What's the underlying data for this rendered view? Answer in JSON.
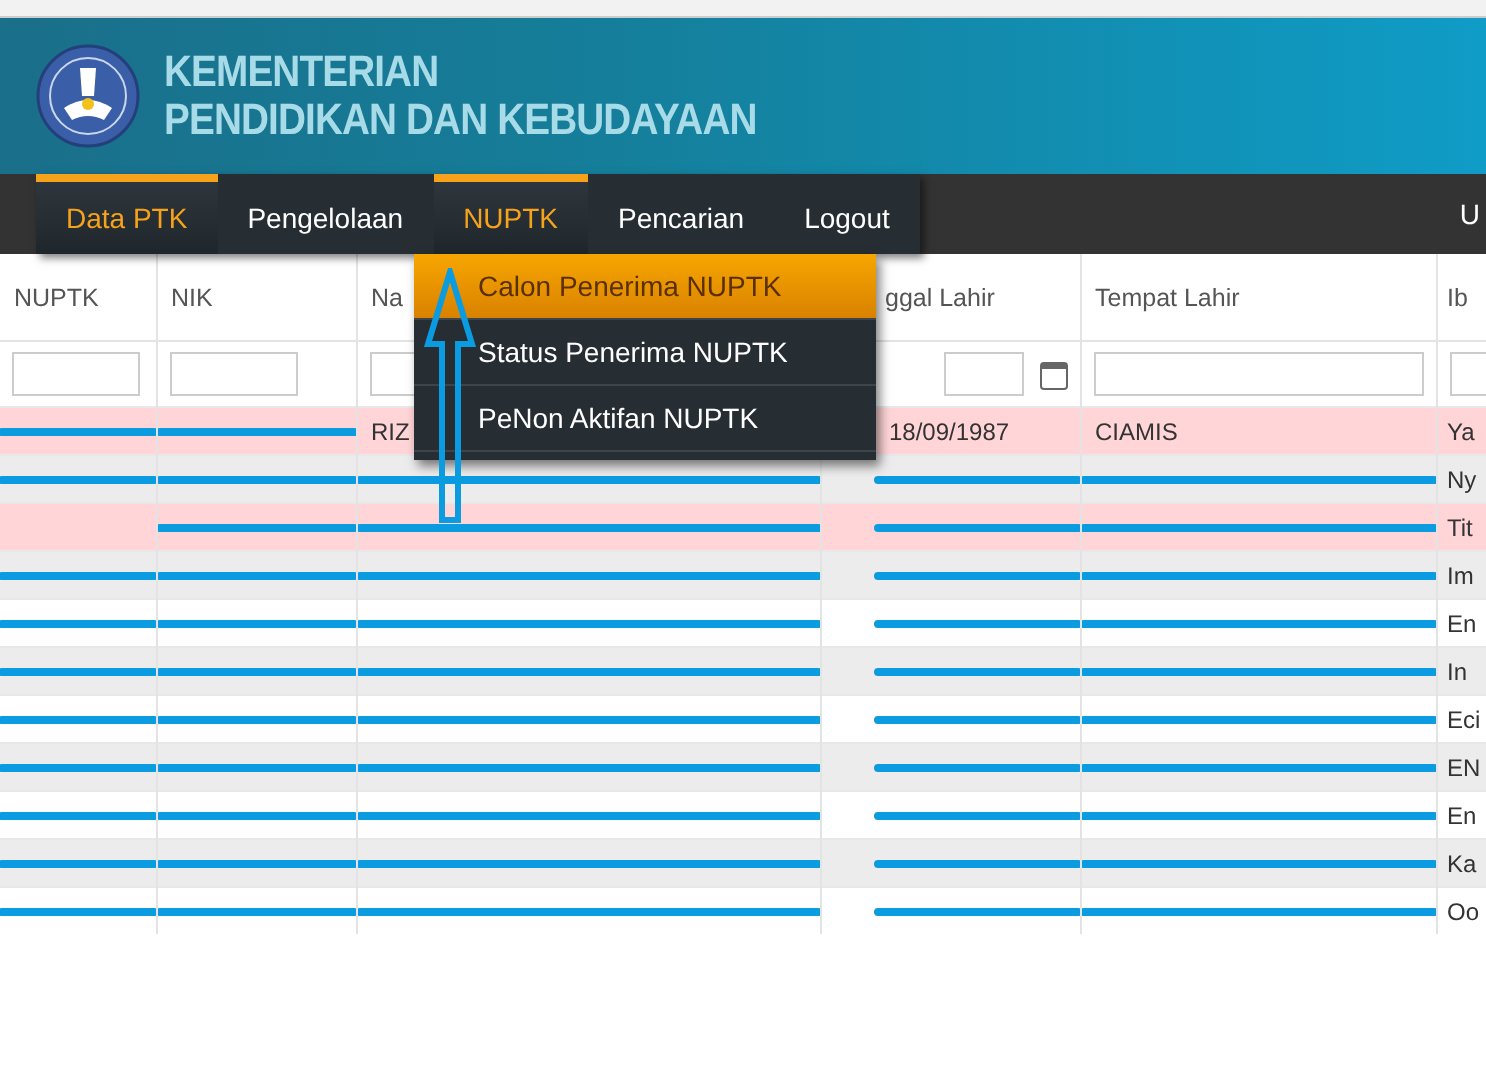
{
  "header": {
    "title_line_1": "KEMENTERIAN",
    "title_line_2": "PENDIDIKAN DAN KEBUDAYAAN"
  },
  "nav": {
    "items": [
      {
        "label": "Data PTK",
        "active": true
      },
      {
        "label": "Pengelolaan",
        "active": false
      },
      {
        "label": "NUPTK",
        "active": true
      },
      {
        "label": "Pencarian",
        "active": false
      },
      {
        "label": "Logout",
        "active": false
      }
    ],
    "user_label": "U"
  },
  "dropdown": {
    "items": [
      {
        "label": "Calon Penerima NUPTK",
        "selected": true
      },
      {
        "label": "Status Penerima NUPTK",
        "selected": false
      },
      {
        "label": "PeNon Aktifan NUPTK",
        "selected": false
      }
    ]
  },
  "table": {
    "columns": [
      {
        "label": "NUPTK",
        "kind": "text"
      },
      {
        "label": "NIK",
        "kind": "text"
      },
      {
        "label": "Na",
        "kind": "text"
      },
      {
        "label": "ggal Lahir",
        "kind": "date"
      },
      {
        "label": "Tempat Lahir",
        "kind": "text"
      },
      {
        "label": "Ib",
        "kind": "text"
      }
    ],
    "rows": [
      {
        "flagged": true,
        "cells": [
          {
            "scribbled": true
          },
          {
            "scribbled": true
          },
          {
            "text": "RIZ",
            "scribbled": false
          },
          {
            "text": "18/09/1987",
            "scribbled": false
          },
          {
            "text": "CIAMIS",
            "scribbled": false
          },
          {
            "text": "Ya",
            "scribbled": false
          }
        ]
      },
      {
        "flagged": false,
        "cells": [
          {
            "scribbled": true
          },
          {
            "scribbled": true
          },
          {
            "scribbled": true
          },
          {
            "scribbled": true
          },
          {
            "scribbled": true
          },
          {
            "text": "Ny",
            "scribbled": false
          }
        ]
      },
      {
        "flagged": true,
        "cells": [
          {
            "scribbled": false
          },
          {
            "scribbled": true
          },
          {
            "scribbled": true
          },
          {
            "scribbled": true
          },
          {
            "scribbled": true
          },
          {
            "text": "Tit",
            "scribbled": false
          }
        ]
      },
      {
        "flagged": false,
        "cells": [
          {
            "scribbled": true
          },
          {
            "scribbled": true
          },
          {
            "scribbled": true
          },
          {
            "scribbled": true
          },
          {
            "scribbled": true
          },
          {
            "text": "Im",
            "scribbled": false
          }
        ]
      },
      {
        "flagged": false,
        "cells": [
          {
            "scribbled": true
          },
          {
            "scribbled": true
          },
          {
            "scribbled": true
          },
          {
            "scribbled": true
          },
          {
            "scribbled": true
          },
          {
            "text": "En",
            "scribbled": false
          }
        ]
      },
      {
        "flagged": false,
        "cells": [
          {
            "scribbled": true
          },
          {
            "scribbled": true
          },
          {
            "scribbled": true
          },
          {
            "scribbled": true
          },
          {
            "scribbled": true
          },
          {
            "text": "In",
            "scribbled": false
          }
        ]
      },
      {
        "flagged": false,
        "cells": [
          {
            "scribbled": true
          },
          {
            "scribbled": true
          },
          {
            "scribbled": true
          },
          {
            "scribbled": true
          },
          {
            "scribbled": true
          },
          {
            "text": "Eci",
            "scribbled": false
          }
        ]
      },
      {
        "flagged": false,
        "cells": [
          {
            "scribbled": true
          },
          {
            "scribbled": true
          },
          {
            "scribbled": true
          },
          {
            "scribbled": true
          },
          {
            "scribbled": true
          },
          {
            "text": "EN",
            "scribbled": false
          }
        ]
      },
      {
        "flagged": false,
        "cells": [
          {
            "scribbled": true
          },
          {
            "scribbled": true
          },
          {
            "scribbled": true
          },
          {
            "scribbled": true
          },
          {
            "scribbled": true
          },
          {
            "text": "En",
            "scribbled": false
          }
        ]
      },
      {
        "flagged": false,
        "cells": [
          {
            "scribbled": true
          },
          {
            "scribbled": true
          },
          {
            "scribbled": true
          },
          {
            "scribbled": true
          },
          {
            "scribbled": true
          },
          {
            "text": "Ka",
            "scribbled": false
          }
        ]
      },
      {
        "flagged": false,
        "cells": [
          {
            "scribbled": true
          },
          {
            "scribbled": true
          },
          {
            "scribbled": true
          },
          {
            "scribbled": true
          },
          {
            "scribbled": true
          },
          {
            "text": "Oo",
            "scribbled": false
          }
        ]
      }
    ]
  }
}
